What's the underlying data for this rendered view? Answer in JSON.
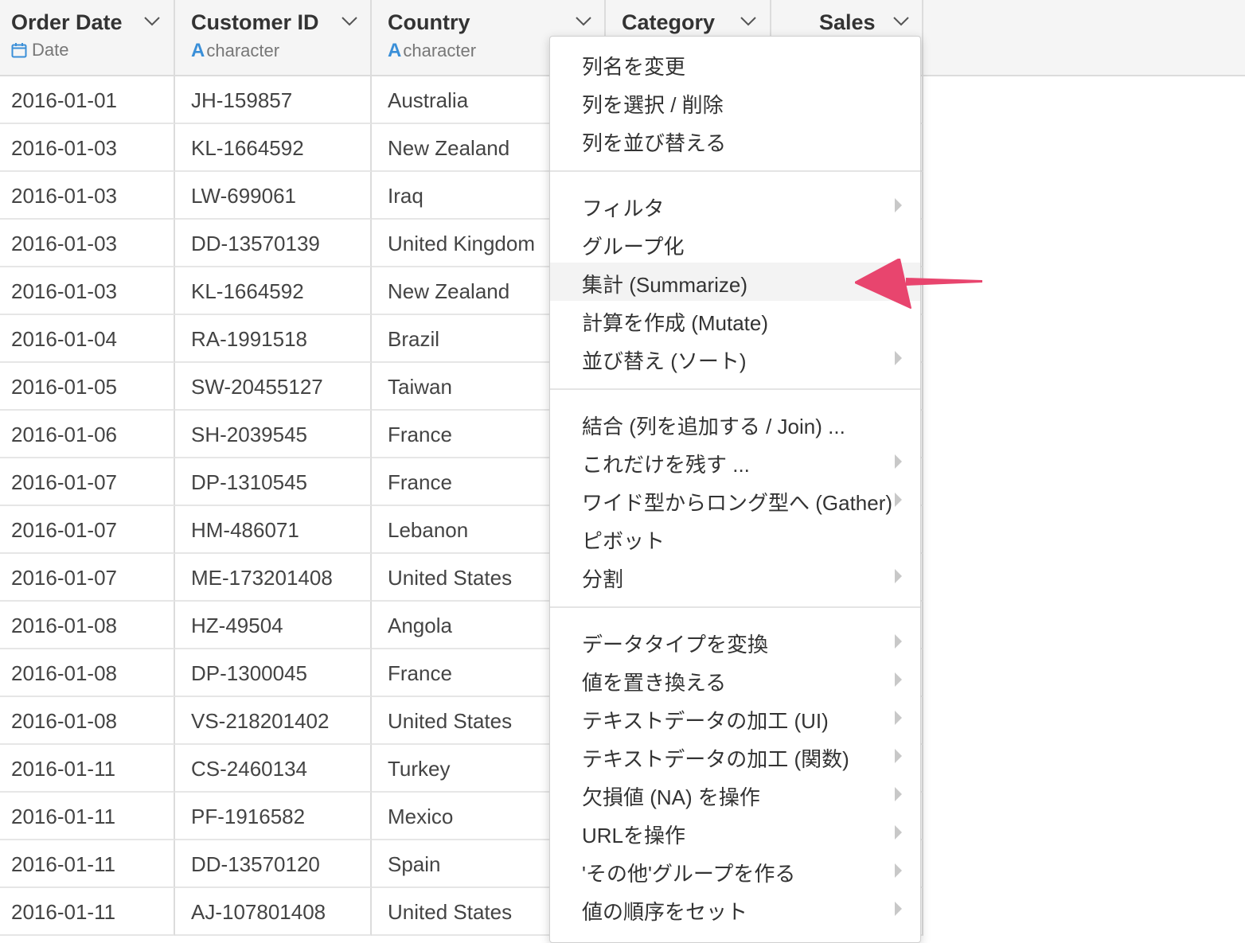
{
  "columns": [
    {
      "name": "Order Date",
      "type": "Date",
      "type_icon": "calendar-icon"
    },
    {
      "name": "Customer ID",
      "type": "character",
      "type_icon": "A"
    },
    {
      "name": "Country",
      "type": "character",
      "type_icon": "A"
    },
    {
      "name": "Category",
      "type": "",
      "type_icon": ""
    },
    {
      "name": "Sales",
      "type": "",
      "type_icon": ""
    }
  ],
  "rows": [
    [
      "2016-01-01",
      "JH-159857",
      "Australia"
    ],
    [
      "2016-01-03",
      "KL-1664592",
      "New Zealand"
    ],
    [
      "2016-01-03",
      "LW-699061",
      "Iraq"
    ],
    [
      "2016-01-03",
      "DD-13570139",
      "United Kingdom"
    ],
    [
      "2016-01-03",
      "KL-1664592",
      "New Zealand"
    ],
    [
      "2016-01-04",
      "RA-1991518",
      "Brazil"
    ],
    [
      "2016-01-05",
      "SW-20455127",
      "Taiwan"
    ],
    [
      "2016-01-06",
      "SH-2039545",
      "France"
    ],
    [
      "2016-01-07",
      "DP-1310545",
      "France"
    ],
    [
      "2016-01-07",
      "HM-486071",
      "Lebanon"
    ],
    [
      "2016-01-07",
      "ME-173201408",
      "United States"
    ],
    [
      "2016-01-08",
      "HZ-49504",
      "Angola"
    ],
    [
      "2016-01-08",
      "DP-1300045",
      "France"
    ],
    [
      "2016-01-08",
      "VS-218201402",
      "United States"
    ],
    [
      "2016-01-11",
      "CS-2460134",
      "Turkey"
    ],
    [
      "2016-01-11",
      "PF-1916582",
      "Mexico"
    ],
    [
      "2016-01-11",
      "DD-13570120",
      "Spain"
    ],
    [
      "2016-01-11",
      "AJ-107801408",
      "United States"
    ]
  ],
  "menu": {
    "groups": [
      [
        {
          "label": "列名を変更",
          "submenu": false
        },
        {
          "label": "列を選択 / 削除",
          "submenu": false
        },
        {
          "label": "列を並び替える",
          "submenu": false
        }
      ],
      [
        {
          "label": "フィルタ",
          "submenu": true
        },
        {
          "label": "グループ化",
          "submenu": false
        },
        {
          "label": "集計 (Summarize)",
          "submenu": false,
          "highlighted": true
        },
        {
          "label": "計算を作成 (Mutate)",
          "submenu": false
        },
        {
          "label": "並び替え (ソート)",
          "submenu": true
        }
      ],
      [
        {
          "label": "結合 (列を追加する / Join) ...",
          "submenu": false
        },
        {
          "label": "これだけを残す ...",
          "submenu": true
        },
        {
          "label": "ワイド型からロング型へ (Gather)",
          "submenu": true
        },
        {
          "label": "ピボット",
          "submenu": false
        },
        {
          "label": "分割",
          "submenu": true
        }
      ],
      [
        {
          "label": "データタイプを変換",
          "submenu": true
        },
        {
          "label": "値を置き換える",
          "submenu": true
        },
        {
          "label": "テキストデータの加工 (UI)",
          "submenu": true
        },
        {
          "label": "テキストデータの加工 (関数)",
          "submenu": true
        },
        {
          "label": "欠損値 (NA) を操作",
          "submenu": true
        },
        {
          "label": "URLを操作",
          "submenu": true
        },
        {
          "label": "'その他'グループを作る",
          "submenu": true
        },
        {
          "label": "値の順序をセット",
          "submenu": true
        }
      ]
    ]
  },
  "colors": {
    "accent": "#3a8fd8",
    "arrow": "#e8456e",
    "highlight": "#f3f3f3"
  }
}
